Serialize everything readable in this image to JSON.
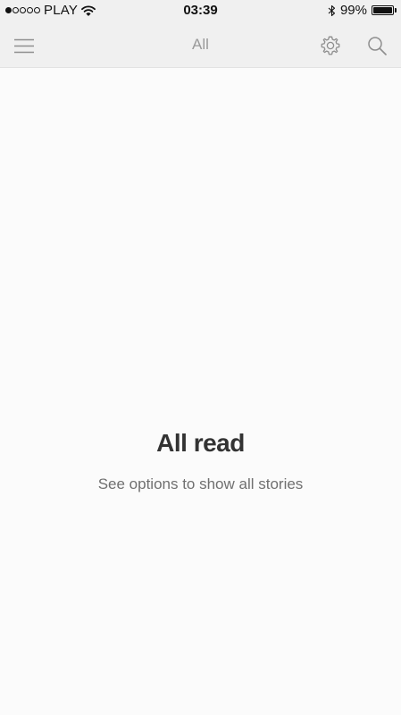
{
  "status_bar": {
    "carrier": "PLAY",
    "time": "03:39",
    "battery_percent": "99%",
    "signal_bars_filled": 1,
    "signal_bars_total": 5,
    "icons": [
      "signal-dots-icon",
      "wifi-icon",
      "bluetooth-icon",
      "battery-icon"
    ]
  },
  "nav_bar": {
    "title": "All",
    "left_icon": "hamburger-menu-icon",
    "right_icons": [
      "gear-icon",
      "search-icon"
    ]
  },
  "empty_state": {
    "title": "All read",
    "subtitle": "See options to show all stories"
  },
  "colors": {
    "bar_background": "#f0f0f0",
    "content_background": "#fbfbfb",
    "title_text": "#333333",
    "subtitle_text": "#707070",
    "nav_title_text": "#9a9a9a",
    "icon_gray": "#8e8e8e"
  }
}
